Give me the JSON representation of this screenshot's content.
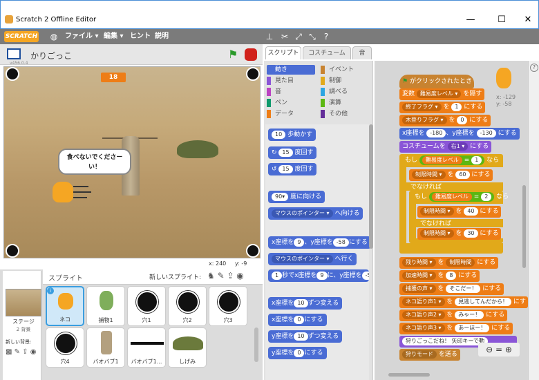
{
  "window": {
    "title": "Scratch 2 Offline Editor",
    "min": "—",
    "max": "☐",
    "close": "✕"
  },
  "menubar": {
    "logo": "SCRATCH",
    "items": [
      "ファイル ▾",
      "編集 ▾",
      "ヒント",
      "説明"
    ],
    "icons": [
      "globe-icon",
      "stamp-icon",
      "cut-icon",
      "grow-icon",
      "shrink-icon",
      "help-icon"
    ]
  },
  "stage": {
    "title": "かりごっこ",
    "version": "v456.0.4",
    "score": "18",
    "speech": "食べないでくださーい！",
    "x_label": "x: 240",
    "y_label": "y: -9"
  },
  "sprites": {
    "header_label": "スプライト",
    "new_sprite_label": "新しいスプライト:",
    "stage_label": "ステージ",
    "backdrop_count": "2 背景",
    "new_backdrop_label": "新しい背景:",
    "items": [
      "ネコ",
      "捕物1",
      "穴1",
      "穴2",
      "穴3",
      "穴4",
      "バオバブ1",
      "バオバブ1...",
      "しげみ"
    ]
  },
  "tabs": [
    "スクリプト",
    "コスチューム",
    "音"
  ],
  "categories": [
    {
      "label": "動き",
      "color": "#4a6cd4"
    },
    {
      "label": "イベント",
      "color": "#c88330"
    },
    {
      "label": "見た目",
      "color": "#8a55d7"
    },
    {
      "label": "制御",
      "color": "#e1a91a"
    },
    {
      "label": "音",
      "color": "#bb42c3"
    },
    {
      "label": "調べる",
      "color": "#2ca5e2"
    },
    {
      "label": "ペン",
      "color": "#0e9a6c"
    },
    {
      "label": "演算",
      "color": "#5cb712"
    },
    {
      "label": "データ",
      "color": "#ee7d16"
    },
    {
      "label": "その他",
      "color": "#632d99"
    }
  ],
  "palette": {
    "move": {
      "val": "10",
      "text": "歩動かす"
    },
    "turn_r": {
      "val": "15",
      "text": "度回す"
    },
    "turn_l": {
      "val": "15",
      "text": "度回す"
    },
    "point": {
      "val": "90▾",
      "text": "度に向ける"
    },
    "toward": {
      "val": "マウスのポインター ▾",
      "text": "へ向ける"
    },
    "goxy_a": "x座標を",
    "goxy_x": "9",
    "goxy_b": "、y座標を",
    "goxy_y": "-58",
    "goxy_c": "にする",
    "goto": {
      "val": "マウスのポインター ▾",
      "text": "へ行く"
    },
    "glide_s": "1",
    "glide_a": "秒でx座標を",
    "glide_x": "9",
    "glide_b": "に、y座標を",
    "glide_y": "-5",
    "chx": {
      "a": "x座標を",
      "val": "10",
      "b": "ずつ変える"
    },
    "setx": {
      "a": "x座標を",
      "val": "0",
      "b": "にする"
    },
    "chy": {
      "a": "y座標を",
      "val": "10",
      "b": "ずつ変える"
    },
    "sety": {
      "a": "y座標を",
      "val": "0",
      "b": "にする"
    }
  },
  "script": {
    "hat": "がクリックされたとき",
    "l1a": "変数",
    "l1b": "難易度レベル ▾",
    "l1c": "を隠す",
    "l2a": "終了フラグ ▾",
    "l2b": "を",
    "l2v": "1",
    "l2c": "にする",
    "l3a": "木登りフラグ ▾",
    "l3b": "を",
    "l3v": "0",
    "l3c": "にする",
    "l4a": "x座標を",
    "l4x": "-180",
    "l4b": "、y座標を",
    "l4y": "-130",
    "l4c": "にする",
    "l5a": "コスチュームを",
    "l5v": "右1 ▾",
    "l5c": "にする",
    "if1a": "もし",
    "if1v": "難易度レベル",
    "if1eq": "=",
    "if1n": "1",
    "if1b": "なら",
    "s1a": "制限時間 ▾",
    "s1b": "を",
    "s1v": "60",
    "s1c": "にする",
    "else1": "でなければ",
    "if2a": "もし",
    "if2v": "難易度レベル",
    "if2eq": "=",
    "if2n": "2",
    "if2b": "なら",
    "s2a": "制限時間 ▾",
    "s2b": "を",
    "s2v": "40",
    "s2c": "にする",
    "else2": "でなければ",
    "s3a": "制限時間 ▾",
    "s3b": "を",
    "s3v": "30",
    "s3c": "にする",
    "r1a": "残り時間 ▾",
    "r1b": "を",
    "r1v": "制限時間",
    "r1c": "にする",
    "r2a": "加速時間 ▾",
    "r2b": "を",
    "r2v": "8",
    "r2c": "にする",
    "r3a": "捕獲の声 ▾",
    "r3b": "を",
    "r3v": "そこだー！",
    "r3c": "にする",
    "r4a": "ネコ語り声1 ▾",
    "r4b": "を",
    "r4v": "見逃してんだから！",
    "r4c": "にす",
    "r5a": "ネコ語り声2 ▾",
    "r5b": "を",
    "r5v": "みゃー！",
    "r5c": "にする",
    "r6a": "ネコ語り声3 ▾",
    "r6b": "を",
    "r6v": "あーほー！",
    "r6c": "にする",
    "r7": "狩りごっこだね！ 矢印キーで動",
    "r8a": "狩りモード",
    "r8b": "を送る",
    "coords_x": "x: -129",
    "coords_y": "y: -58"
  }
}
